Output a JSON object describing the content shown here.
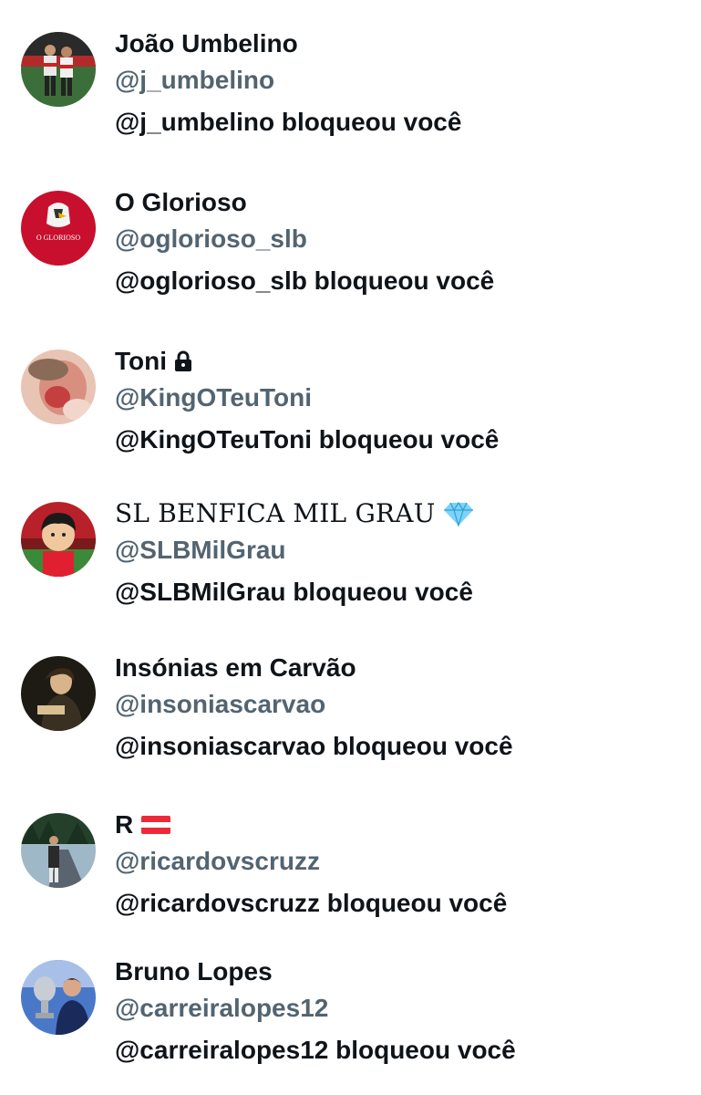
{
  "accounts": [
    {
      "name": "João Umbelino",
      "handle": "@j_umbelino",
      "status": "@j_umbelino bloqueou você",
      "avatar": "football-players-avatar"
    },
    {
      "name": "O Glorioso",
      "handle": "@oglorioso_slb",
      "status": "@oglorioso_slb bloqueou você",
      "avatar": "eagle-logo-avatar",
      "avatar_text": "O GLORIOSO",
      "avatar_color": "#c8102e"
    },
    {
      "name": "Toni",
      "handle": "@KingOTeuToni",
      "status": "@KingOTeuToni bloqueou você",
      "avatar": "blurry-face-avatar",
      "badge": "lock-icon"
    },
    {
      "name": "SL BENFICA MIL GRAU",
      "handle": "@SLBMilGrau",
      "status": "@SLBMilGrau bloqueou você",
      "avatar": "cartoon-stadium-avatar",
      "badge": "gem-icon"
    },
    {
      "name": "Insónias em Carvão",
      "handle": "@insoniascarvao",
      "status": "@insoniascarvao bloqueou você",
      "avatar": "painting-portrait-avatar"
    },
    {
      "name": "R",
      "handle": "@ricardovscruzz",
      "status": "@ricardovscruzz bloqueou você",
      "avatar": "road-landscape-avatar",
      "badge": "austria-flag-icon"
    },
    {
      "name": "Bruno Lopes",
      "handle": "@carreiralopes12",
      "status": "@carreiralopes12 bloqueou você",
      "avatar": "trophy-photo-avatar"
    }
  ],
  "colors": {
    "text": "#0f1419",
    "muted": "#536471",
    "benfica_red": "#c8102e"
  }
}
